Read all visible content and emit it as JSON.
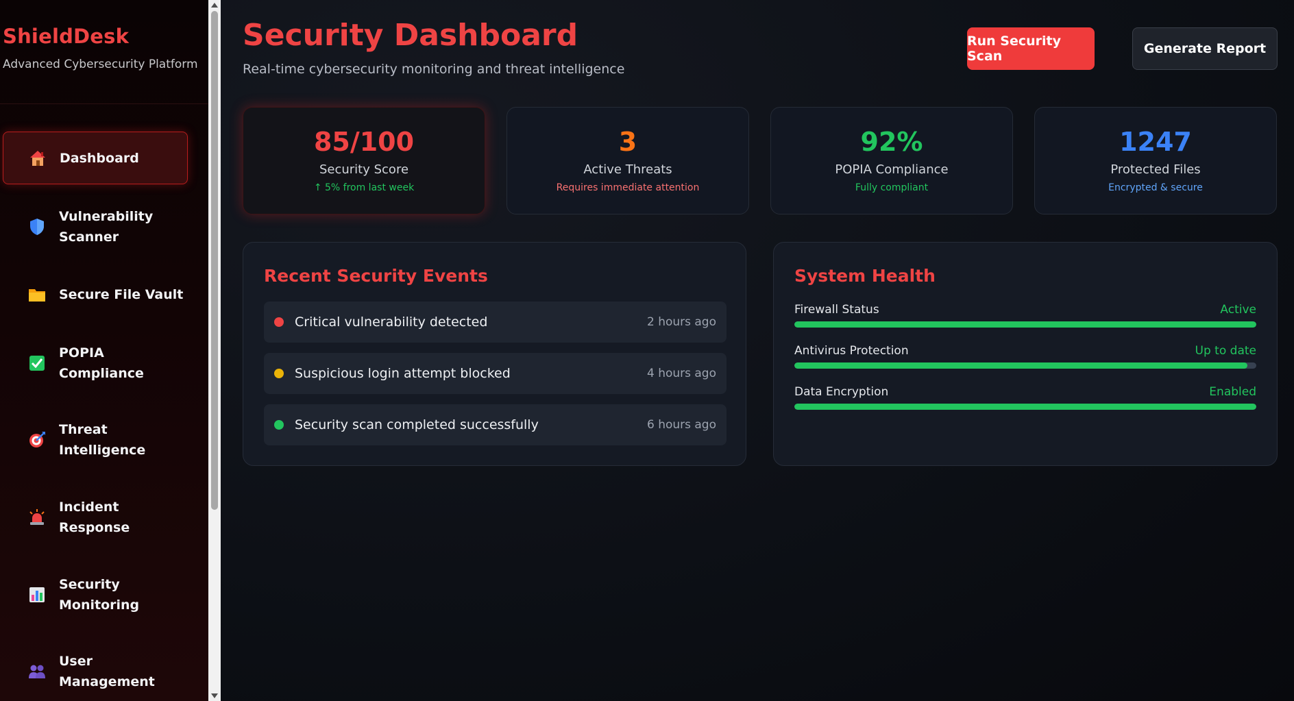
{
  "brand": {
    "title": "ShieldDesk",
    "subtitle": "Advanced Cybersecurity Platform"
  },
  "nav": [
    {
      "label": "Dashboard",
      "icon": "house-icon",
      "active": true
    },
    {
      "label": "Vulnerability Scanner",
      "icon": "shield-icon",
      "active": false
    },
    {
      "label": "Secure File Vault",
      "icon": "folder-icon",
      "active": false
    },
    {
      "label": "POPIA Compliance",
      "icon": "check-box-icon",
      "active": false
    },
    {
      "label": "Threat Intelligence",
      "icon": "target-icon",
      "active": false
    },
    {
      "label": "Incident Response",
      "icon": "siren-icon",
      "active": false
    },
    {
      "label": "Security Monitoring",
      "icon": "bar-chart-icon",
      "active": false
    },
    {
      "label": "User Management",
      "icon": "users-icon",
      "active": false
    }
  ],
  "header": {
    "title": "Security Dashboard",
    "subtitle": "Real-time cybersecurity monitoring and threat intelligence",
    "scan_button": "Run Security Scan",
    "report_button": "Generate Report"
  },
  "stats": [
    {
      "value": "85/100",
      "label": "Security Score",
      "note": "↑ 5% from last week",
      "value_color": "#ef4444",
      "note_color": "#22c55e"
    },
    {
      "value": "3",
      "label": "Active Threats",
      "note": "Requires immediate attention",
      "value_color": "#f97316",
      "note_color": "#f87171"
    },
    {
      "value": "92%",
      "label": "POPIA Compliance",
      "note": "Fully compliant",
      "value_color": "#22c55e",
      "note_color": "#22c55e"
    },
    {
      "value": "1247",
      "label": "Protected Files",
      "note": "Encrypted & secure",
      "value_color": "#3b82f6",
      "note_color": "#60a5fa"
    }
  ],
  "events": {
    "title": "Recent Security Events",
    "items": [
      {
        "text": "Critical vulnerability detected",
        "time": "2 hours ago",
        "color": "#ef4444"
      },
      {
        "text": "Suspicious login attempt blocked",
        "time": "4 hours ago",
        "color": "#eab308"
      },
      {
        "text": "Security scan completed successfully",
        "time": "6 hours ago",
        "color": "#22c55e"
      }
    ]
  },
  "health": {
    "title": "System Health",
    "items": [
      {
        "name": "Firewall Status",
        "status": "Active",
        "level": 1.0
      },
      {
        "name": "Antivirus Protection",
        "status": "Up to date",
        "level": 0.98
      },
      {
        "name": "Data Encryption",
        "status": "Enabled",
        "level": 1.0
      }
    ]
  }
}
